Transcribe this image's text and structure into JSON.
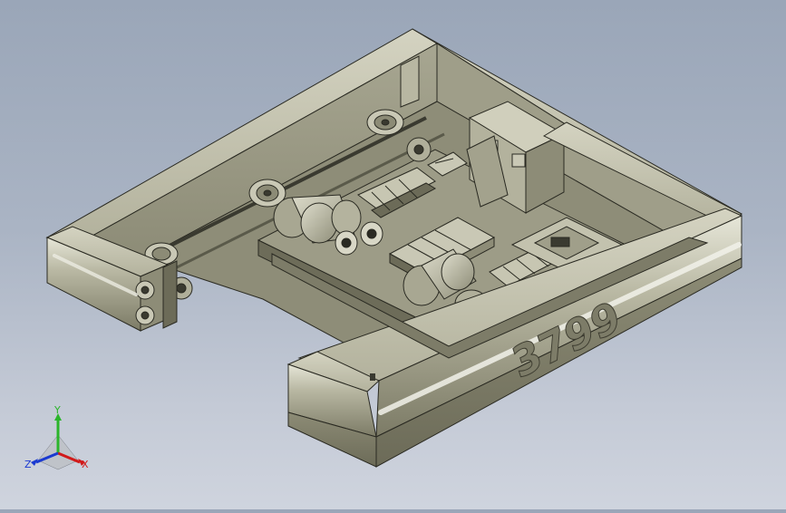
{
  "viewport": {
    "part_number": "3799",
    "colors": {
      "background_top": "#9aa6b8",
      "background_bottom": "#cfd4de",
      "frame_light": "#c8c7b4",
      "frame_mid": "#a9a893",
      "frame_dark": "#74735f",
      "edge": "#2a2a22"
    }
  },
  "triad": {
    "x_label": "X",
    "y_label": "Y",
    "z_label": "Z",
    "x_color": "#d11a1a",
    "y_color": "#2bb52b",
    "z_color": "#1a3ad1"
  }
}
